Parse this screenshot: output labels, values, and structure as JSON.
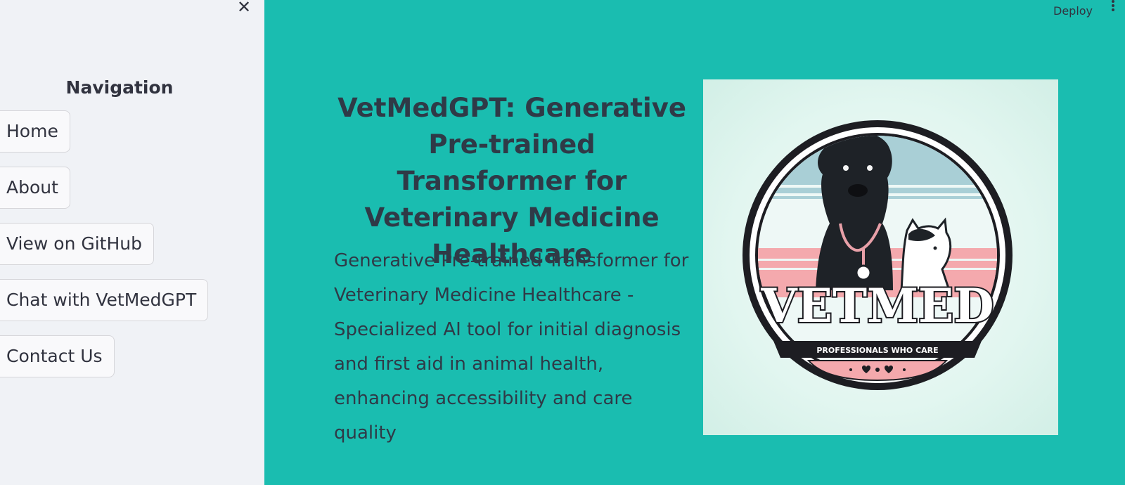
{
  "sidebar": {
    "close_label": "✕",
    "title": "Navigation",
    "items": [
      {
        "label": "Home"
      },
      {
        "label": "About"
      },
      {
        "label": "View on GitHub"
      },
      {
        "label": "Chat with VetMedGPT"
      },
      {
        "label": "Contact Us"
      }
    ]
  },
  "header": {
    "deploy_label": "Deploy",
    "menu_icon": "kebab-menu-icon"
  },
  "main": {
    "title": "VetMedGPT: Generative Pre-trained Transformer for Veterinary Medicine Healthcare",
    "description": "Generative Pre-trained Transformer for Veterinary Medicine Healthcare - Specialized AI tool for initial diagnosis and first aid in animal health, enhancing accessibility and care quality"
  },
  "logo": {
    "wordmark": "VETMED",
    "tagline": "PROFESSIONALS WHO CARE"
  },
  "colors": {
    "main_bg": "#1abdb0",
    "sidebar_bg": "#f0f2f6",
    "text": "#2f3a47",
    "logo_pink": "#f4a9ad",
    "logo_blue": "#a9cfd6"
  }
}
